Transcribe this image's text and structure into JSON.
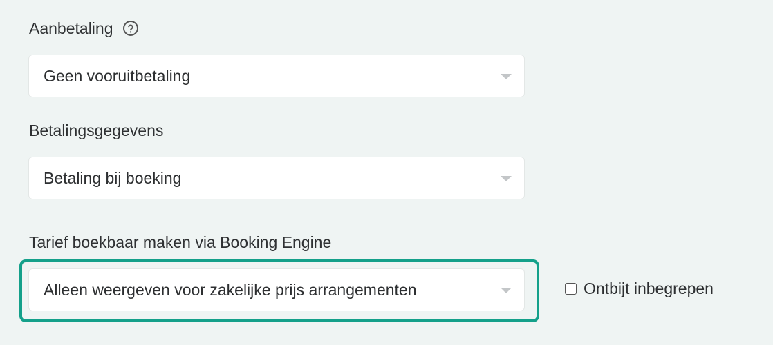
{
  "fields": {
    "aanbetaling": {
      "label": "Aanbetaling",
      "help_icon": "question-circle-icon",
      "value": "Geen vooruitbetaling"
    },
    "betalingsgegevens": {
      "label": "Betalingsgegevens",
      "value": "Betaling bij boeking"
    },
    "booking_engine": {
      "label": "Tarief boekbaar maken via Booking Engine",
      "value": "Alleen weergeven voor zakelijke prijs arrangementen"
    }
  },
  "breakfast_checkbox": {
    "label": "Ontbijt inbegrepen",
    "checked": false
  },
  "colors": {
    "background": "#eff4f3",
    "highlight": "#14a08a",
    "caret": "#c3c6c8"
  }
}
